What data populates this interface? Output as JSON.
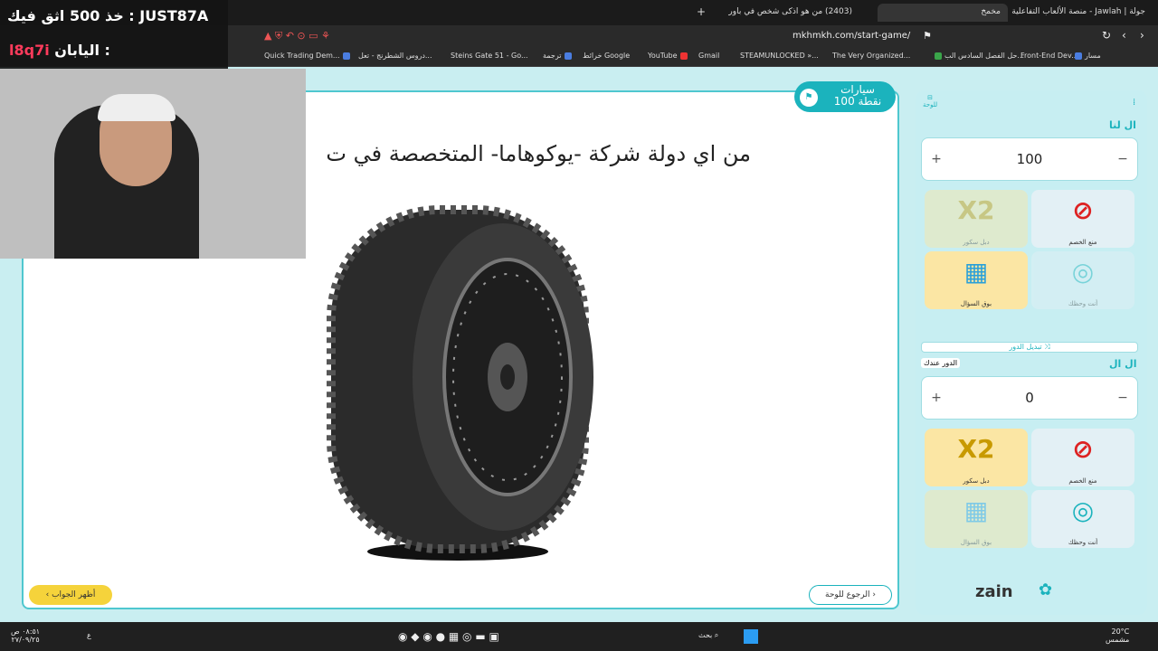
{
  "browser": {
    "tabs": [
      {
        "label": "جولة | Jawlah - منصة الألعاب التفاعلية"
      },
      {
        "label": "مخمخ"
      },
      {
        "label": "(2403) من هو اذكى شخص في باور"
      }
    ],
    "new_tab": "+",
    "url": "mkhmkh.com/start-game/",
    "bookmarks": [
      "Front-End Dev...",
      "مسار",
      "حل الفصل السادس الب...",
      "The Very Organized...",
      "STEAMUNLOCKED »...",
      "Gmail",
      "YouTube",
      "خرائط Google",
      "ترجمة",
      "Steins Gate 51 - Go...",
      "دروس الشطرنج - تعل...",
      "Quick Trading Dem..."
    ]
  },
  "overlay": {
    "promo_line": "خذ 500 اثق فيك : JUST87A",
    "code_line_label": "اليابان :",
    "code_line_code": "l8q7i"
  },
  "game": {
    "category": {
      "name": "سيارات",
      "points": "100 نقطة"
    },
    "question": "من اي دولة شركة -يوكوهاما- المتخصصة في ت",
    "show_answer": "أظهر الجواب",
    "back_to_board": "الرجوع للوحة"
  },
  "sidebar": {
    "board_link": "للوحة",
    "team1": {
      "name": "ال لنا",
      "score": "100"
    },
    "team2": {
      "name": "ال ال",
      "score": "0",
      "turn_label": "الدور عندك"
    },
    "switch_turn": "تبديل الدور",
    "tools": [
      {
        "id": "block",
        "label": "منع الخصم"
      },
      {
        "id": "double",
        "label": "دبل سكور",
        "icon": "X2"
      },
      {
        "id": "luck",
        "label": "أنت وحظك"
      },
      {
        "id": "trumpet",
        "label": "بوق السؤال"
      }
    ],
    "sponsor": "zain"
  },
  "taskbar": {
    "search": "بحث",
    "weather": "20°C",
    "weather_desc": "مشمس",
    "time": "٠٨:٥١ ص",
    "date": "٢٧/٠٩/٢٥",
    "lang": "ع"
  }
}
